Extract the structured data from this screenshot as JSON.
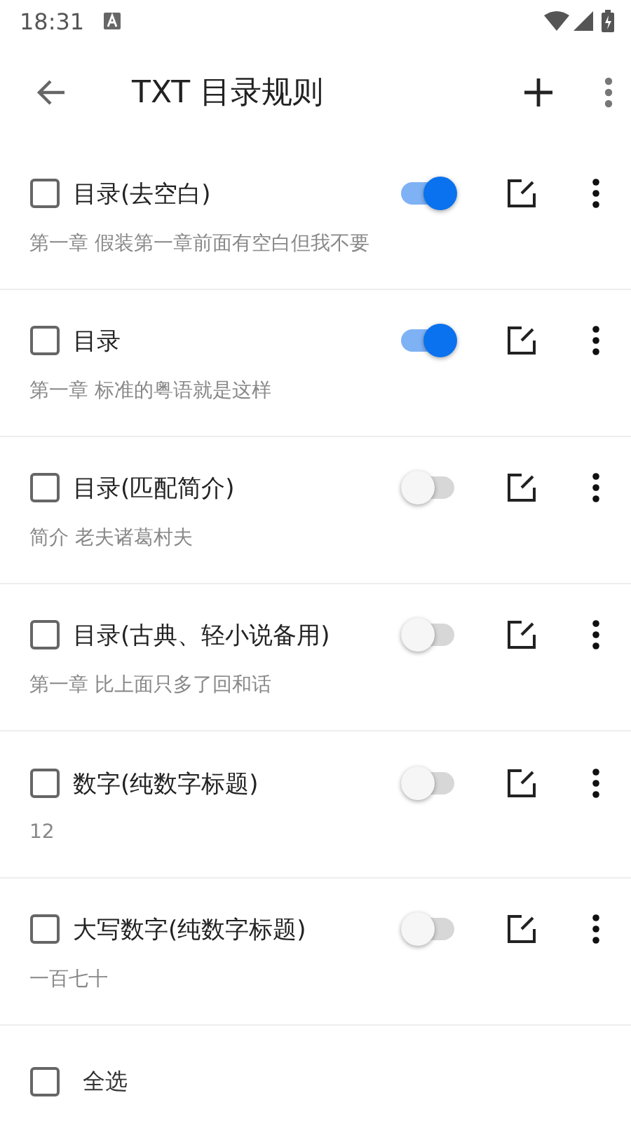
{
  "status_bar": {
    "time": "18:31"
  },
  "toolbar": {
    "title": "TXT 目录规则"
  },
  "rules": [
    {
      "name": "目录(去空白)",
      "example": "第一章 假装第一章前面有空白但我不要",
      "checked": false,
      "enabled": true
    },
    {
      "name": "目录",
      "example": "第一章 标准的粤语就是这样",
      "checked": false,
      "enabled": true
    },
    {
      "name": "目录(匹配简介)",
      "example": "简介 老夫诸葛村夫",
      "checked": false,
      "enabled": false
    },
    {
      "name": "目录(古典、轻小说备用)",
      "example": "第一章 比上面只多了回和话",
      "checked": false,
      "enabled": false
    },
    {
      "name": "数字(纯数字标题)",
      "example": "12",
      "checked": false,
      "enabled": false
    },
    {
      "name": "大写数字(纯数字标题)",
      "example": "一百七十",
      "checked": false,
      "enabled": false
    }
  ],
  "bottom_bar": {
    "select_all": {
      "label": "全选",
      "checked": false
    }
  }
}
